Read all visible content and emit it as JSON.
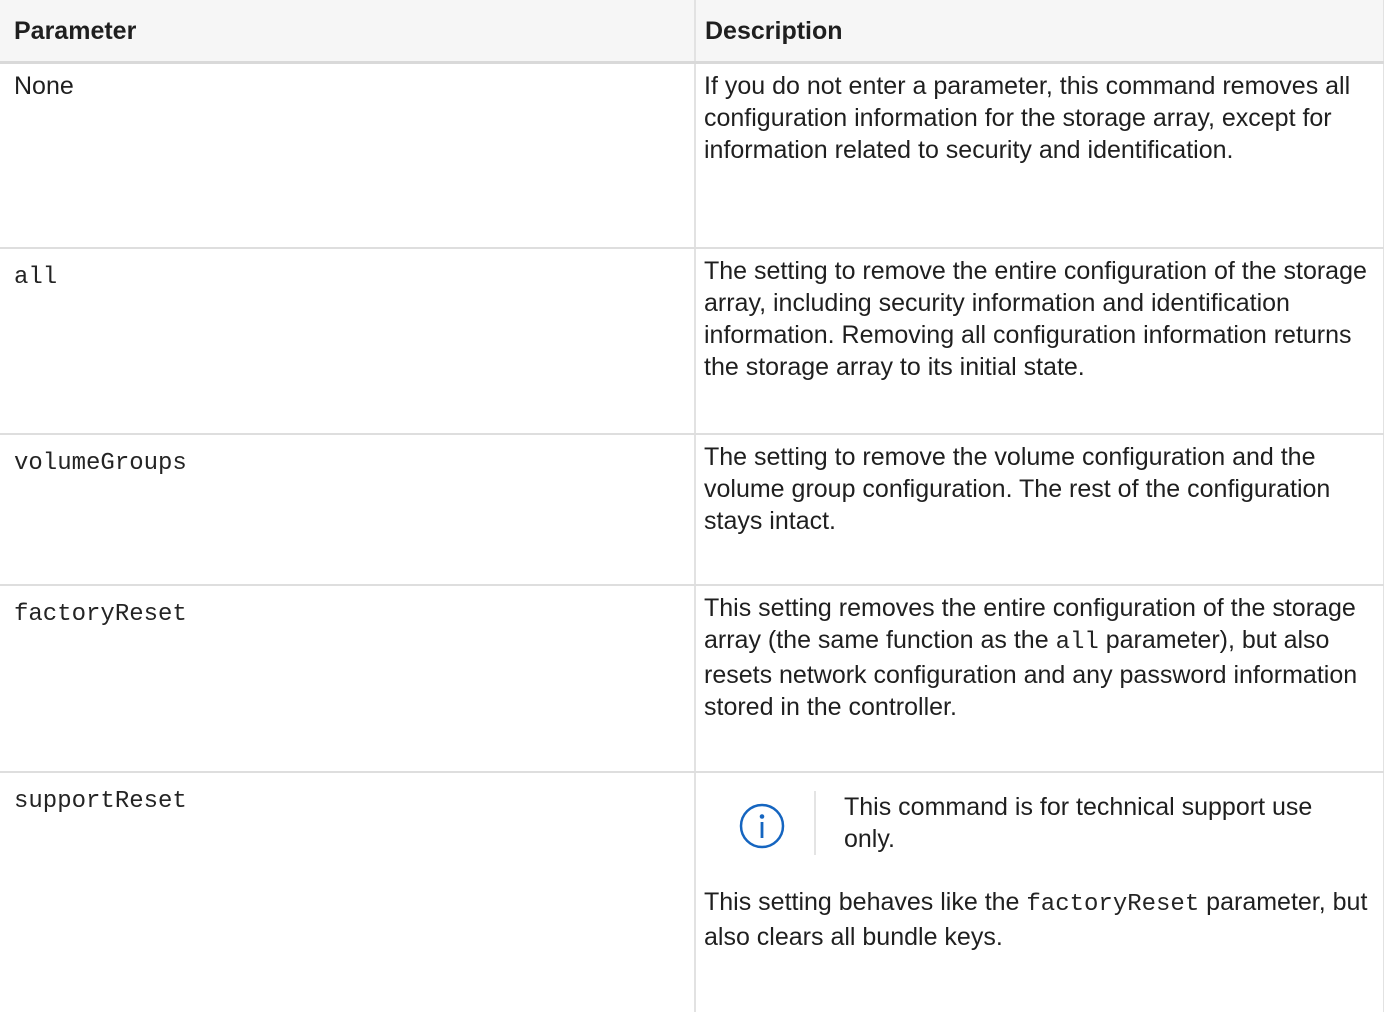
{
  "table": {
    "headers": {
      "parameter": "Parameter",
      "description": "Description"
    },
    "rows": [
      {
        "name": "None",
        "description": "If you do not enter a parameter, this command removes all configuration information for the storage array, except for information related to security and identification."
      },
      {
        "name": "all",
        "description": "The setting to remove the entire configuration of the storage array, including security information and identification information. Removing all configuration information returns the storage array to its initial state."
      },
      {
        "name": "volumeGroups",
        "description": "The setting to remove the volume configuration and the volume group configuration. The rest of the configuration stays intact."
      },
      {
        "name": "factoryReset",
        "description_before": "This setting removes the entire configuration of the storage array (the same function as the ",
        "description_code": "all",
        "description_after": " parameter), but also resets network configuration and any password information stored in the controller."
      },
      {
        "name": "supportReset",
        "note": {
          "icon": "info-icon",
          "text": "This command is for technical support use only."
        },
        "description_before": "This setting behaves like the ",
        "description_code": "factoryReset",
        "description_after": " parameter, but also clears all bundle keys."
      }
    ]
  },
  "colors": {
    "info_icon": "#1565c0",
    "header_bg": "#f6f6f6",
    "border": "#dedede"
  }
}
